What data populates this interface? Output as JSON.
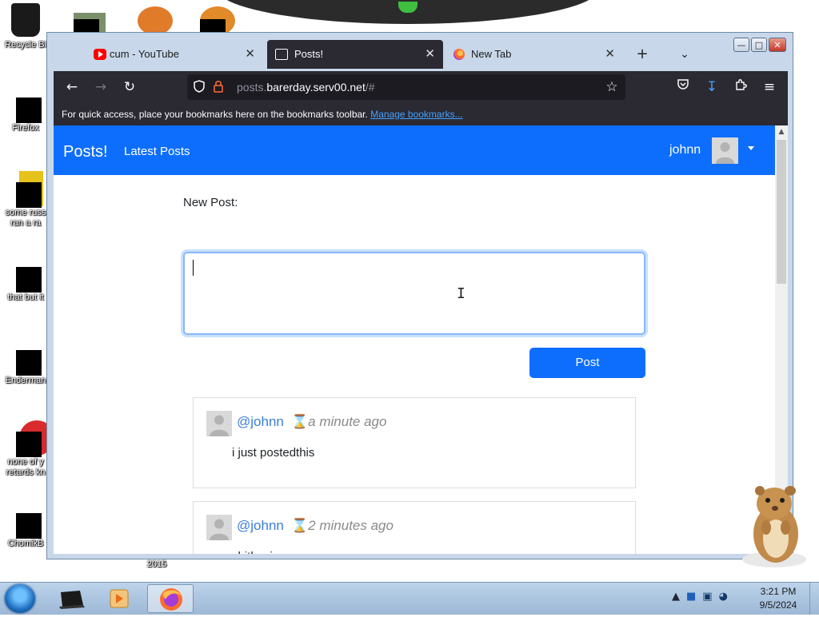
{
  "desktop": {
    "icons": [
      {
        "label": "Recycle Bi"
      },
      {
        "label": "Firefox"
      },
      {
        "label": "some russ ran a ra"
      },
      {
        "label": "that but it"
      },
      {
        "label": "Enderman"
      },
      {
        "label": "none of y retards kn"
      },
      {
        "label": "ChomikB"
      }
    ],
    "stray_label": "2015"
  },
  "browser": {
    "tabs": [
      {
        "title": "cum - YouTube",
        "icon": "youtube-icon",
        "active": false
      },
      {
        "title": "Posts!",
        "icon": "page-icon",
        "active": true
      },
      {
        "title": "New Tab",
        "icon": "firefox-icon",
        "active": false
      }
    ],
    "url": {
      "prefix": "posts.",
      "host": "barerday.serv00.net",
      "suffix": "/#"
    },
    "bookmarks_bar": {
      "text": "For quick access, place your bookmarks here on the bookmarks toolbar.",
      "link": "Manage bookmarks..."
    }
  },
  "site": {
    "brand": "Posts!",
    "nav_link": "Latest Posts",
    "user": "johnn",
    "new_post_label": "New Post:",
    "post_button": "Post",
    "posts": [
      {
        "handle": "@johnn",
        "time": "a minute ago",
        "body": "i just postedthis"
      },
      {
        "handle": "@johnn",
        "time": "2 minutes ago",
        "body": "shitbpsing"
      }
    ],
    "accent_color": "#0d6efd"
  },
  "taskbar": {
    "time": "3:21 PM",
    "date": "9/5/2024"
  }
}
